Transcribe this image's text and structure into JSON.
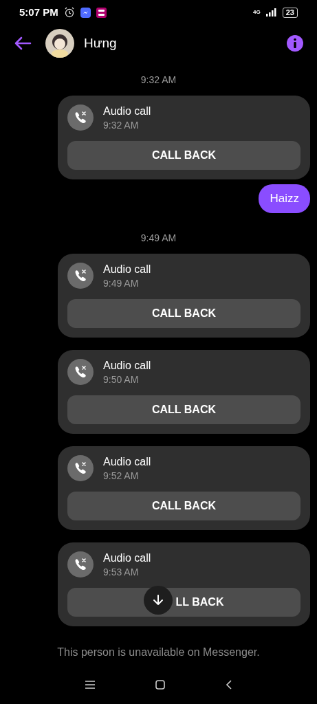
{
  "status_bar": {
    "time": "5:07 PM",
    "network": "4G",
    "battery": "23"
  },
  "header": {
    "name": "Hưng"
  },
  "messages": [
    {
      "kind": "timestamp",
      "text": "9:32 AM"
    },
    {
      "kind": "call",
      "title": "Audio call",
      "time": "9:32 AM",
      "button": "CALL BACK",
      "scroll_button": false
    },
    {
      "kind": "outgoing",
      "text": "Haizz"
    },
    {
      "kind": "timestamp",
      "text": "9:49 AM"
    },
    {
      "kind": "call",
      "title": "Audio call",
      "time": "9:49 AM",
      "button": "CALL BACK",
      "scroll_button": false
    },
    {
      "kind": "call",
      "title": "Audio call",
      "time": "9:50 AM",
      "button": "CALL BACK",
      "scroll_button": false
    },
    {
      "kind": "call",
      "title": "Audio call",
      "time": "9:52 AM",
      "button": "CALL BACK",
      "scroll_button": false
    },
    {
      "kind": "call",
      "title": "Audio call",
      "time": "9:53 AM",
      "button": "LL BACK",
      "scroll_button": true
    }
  ],
  "footer": {
    "text": "This person is unavailable on Messenger."
  }
}
